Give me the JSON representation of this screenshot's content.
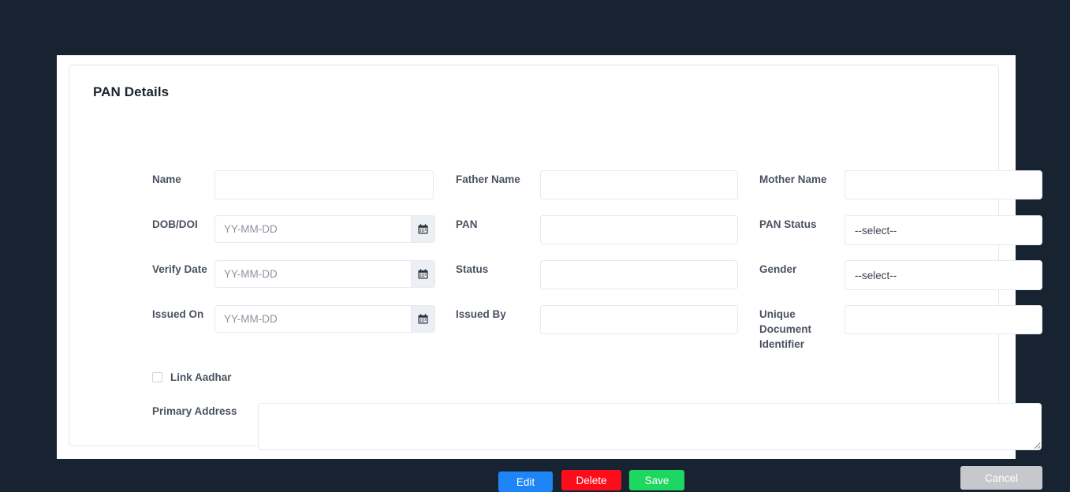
{
  "card": {
    "title": "PAN Details"
  },
  "fields": {
    "name": {
      "label": "Name",
      "value": "",
      "placeholder": ""
    },
    "father_name": {
      "label": "Father Name",
      "value": "",
      "placeholder": ""
    },
    "mother_name": {
      "label": "Mother Name",
      "value": "",
      "placeholder": ""
    },
    "dob_doi": {
      "label": "DOB/DOI",
      "value": "",
      "placeholder": "YY-MM-DD",
      "icon": "calendar-icon"
    },
    "pan": {
      "label": "PAN",
      "value": "",
      "placeholder": ""
    },
    "pan_status": {
      "label": "PAN Status",
      "value": "--select--"
    },
    "verify_date": {
      "label": "Verify Date",
      "value": "",
      "placeholder": "YY-MM-DD",
      "icon": "calendar-icon"
    },
    "status": {
      "label": "Status",
      "value": "",
      "placeholder": ""
    },
    "gender": {
      "label": "Gender",
      "value": "--select--"
    },
    "issued_on": {
      "label": "Issued On",
      "value": "",
      "placeholder": "YY-MM-DD",
      "icon": "calendar-icon"
    },
    "issued_by": {
      "label": "Issued By",
      "value": "",
      "placeholder": ""
    },
    "unique_document_identifier": {
      "label": "Unique Document Identifier",
      "value": "",
      "placeholder": ""
    },
    "link_aadhar": {
      "label": "Link Aadhar",
      "checked": false
    },
    "primary_address": {
      "label": "Primary Address",
      "value": "",
      "placeholder": ""
    }
  },
  "buttons": {
    "edit": {
      "label": "Edit",
      "color": "#1e85f7"
    },
    "delete": {
      "label": "Delete",
      "color": "#fc0d1b"
    },
    "save": {
      "label": "Save",
      "color": "#1ed760"
    },
    "cancel": {
      "label": "Cancel",
      "color": "#c6c8cb"
    }
  },
  "colors": {
    "page_background": "#172331",
    "card_background": "#ffffff",
    "label_text": "#4a5260",
    "input_border": "#e6e9ec"
  }
}
